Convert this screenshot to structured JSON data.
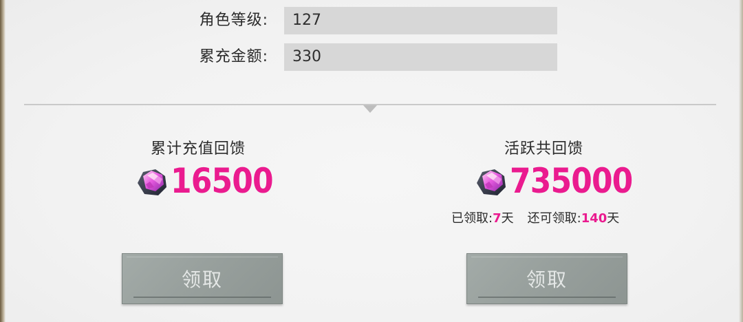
{
  "form": {
    "level_label": "角色等级:",
    "level_value": "127",
    "recharge_label": "累充金额:",
    "recharge_value": "330"
  },
  "left_panel": {
    "title": "累计充值回馈",
    "amount": "16500",
    "button_label": "领取",
    "icon": "pink-gem-icon"
  },
  "right_panel": {
    "title": "活跃共回馈",
    "amount": "735000",
    "claimed_prefix": "已领取:",
    "claimed_days": "7",
    "claimed_suffix": "天",
    "remaining_prefix": "还可领取:",
    "remaining_days": "140",
    "remaining_suffix": "天",
    "button_label": "领取",
    "icon": "pink-gem-icon"
  },
  "colors": {
    "accent_pink": "#ea1b8f",
    "button_gray": "#98a09d",
    "field_gray": "#d7d7d7"
  }
}
